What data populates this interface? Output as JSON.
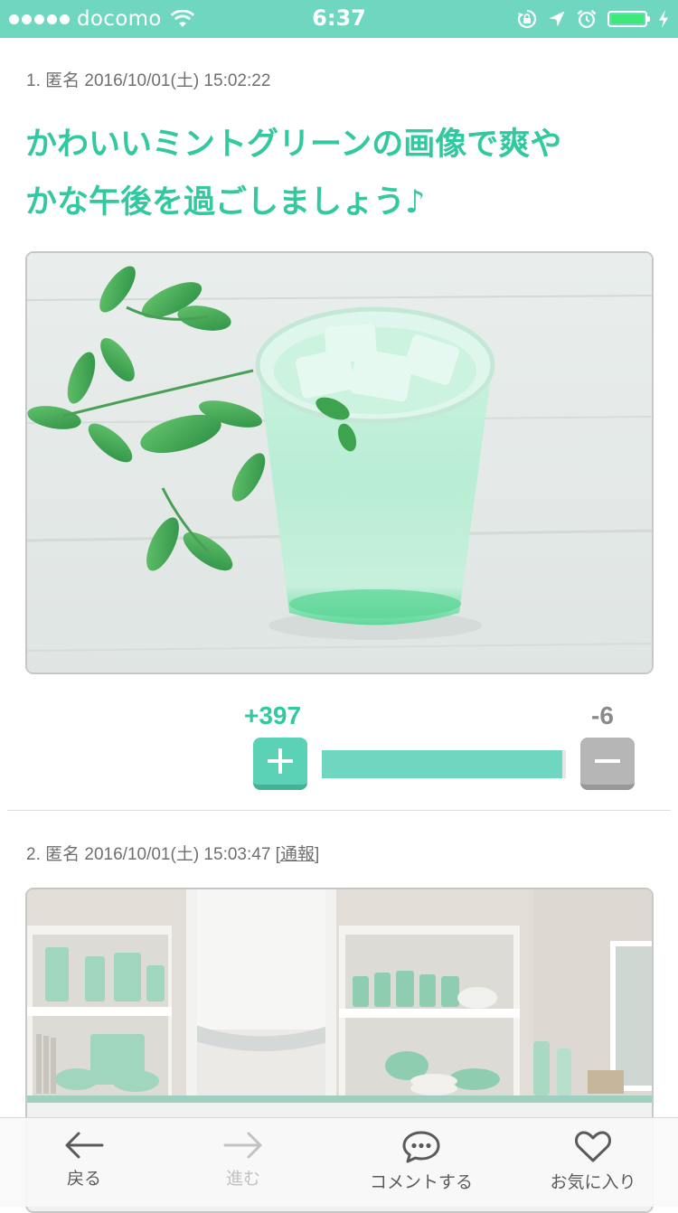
{
  "status_bar": {
    "carrier": "docomo",
    "time": "6:37",
    "signal_bars": 5,
    "battery_level": 1.0,
    "icons": [
      "wifi-icon",
      "rotation-lock-icon",
      "location-arrow-icon",
      "alarm-icon",
      "battery-icon",
      "charging-bolt-icon"
    ]
  },
  "posts": [
    {
      "meta": "1. 匿名 2016/10/01(土) 15:02:22",
      "title_line1": "かわいいミントグリーンの画像で爽や",
      "title_line2": "かな午後を過ごしましょう♪",
      "vote": {
        "plus": "+397",
        "minus": "-6",
        "plus_ratio": 0.985
      }
    },
    {
      "meta": "2. 匿名 2016/10/01(土) 15:03:47",
      "report_link": "[通報]"
    }
  ],
  "toolbar": {
    "back": "戻る",
    "forward": "進む",
    "comment": "コメントする",
    "favorite": "お気に入り"
  },
  "colors": {
    "accent": "#32c8a0",
    "status_bar": "#6fd6c0",
    "plus_button": "#5bd2b5",
    "minus_button": "#b6b6b6",
    "vote_bar": "#6fd6c0"
  }
}
